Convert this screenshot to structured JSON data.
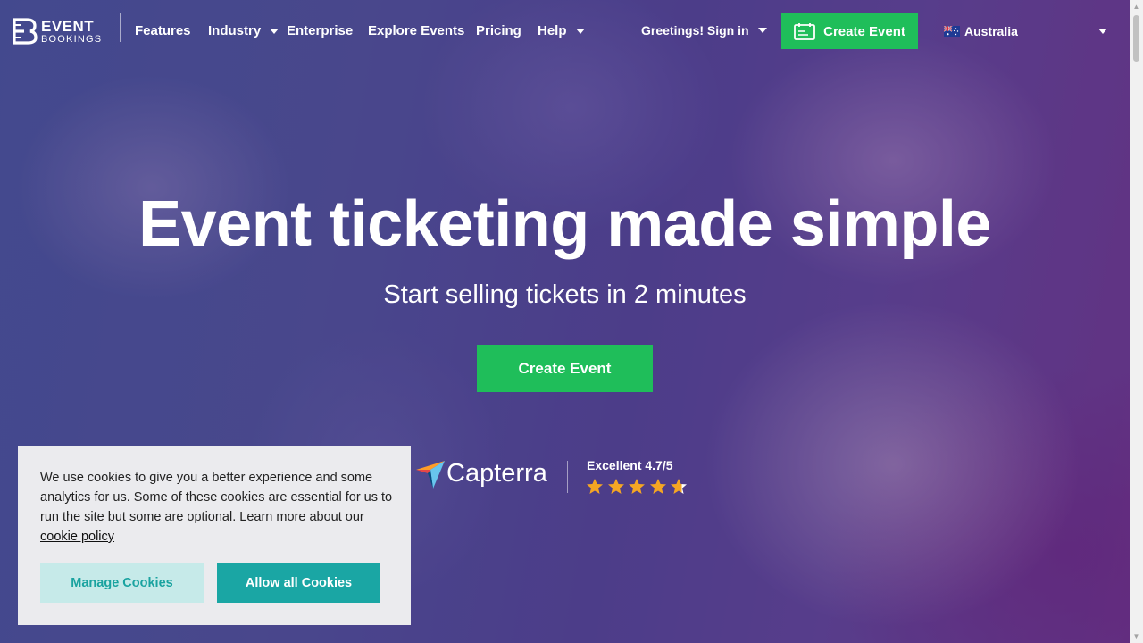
{
  "header": {
    "logo": {
      "line1": "EVENT",
      "line2": "BOOKINGS"
    },
    "nav": [
      {
        "label": "Features"
      },
      {
        "label": "Industry"
      },
      {
        "label": "Enterprise"
      },
      {
        "label": "Explore Events"
      },
      {
        "label": "Pricing"
      },
      {
        "label": "Help"
      }
    ],
    "signin_label": "Greetings! Sign in",
    "create_event_label": "Create Event",
    "country_label": "Australia"
  },
  "hero": {
    "title": "Event ticketing made simple",
    "subtitle": "Start selling tickets in 2 minutes",
    "cta_label": "Create Event"
  },
  "rating": {
    "brand": "Capterra",
    "label": "Excellent 4.7/5",
    "value": 4.7,
    "max": 5,
    "star_color": "#f5a623"
  },
  "cookie_banner": {
    "text": "We use cookies to give you a better experience and some analytics for us. Some of these cookies are essential for us to run the site but some are optional. Learn more about our",
    "link_text": "cookie policy",
    "manage_label": "Manage Cookies",
    "allow_label": "Allow all Cookies"
  },
  "colors": {
    "accent_green": "#1fbe5a",
    "cookie_teal": "#1aa6a4",
    "cookie_teal_light": "#c6eae9"
  }
}
